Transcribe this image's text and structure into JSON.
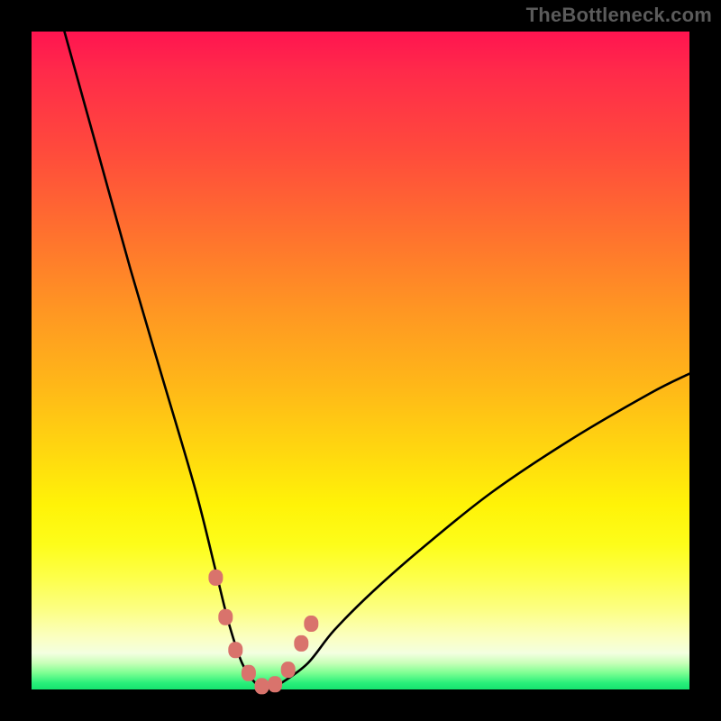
{
  "watermark": "TheBottleneck.com",
  "chart_data": {
    "type": "line",
    "title": "",
    "xlabel": "",
    "ylabel": "",
    "xlim": [
      0,
      100
    ],
    "ylim": [
      0,
      100
    ],
    "series": [
      {
        "name": "bottleneck-curve",
        "x": [
          5,
          10,
          15,
          20,
          25,
          28,
          30,
          32,
          34,
          36,
          38,
          42,
          46,
          52,
          60,
          70,
          82,
          94,
          100
        ],
        "values": [
          100,
          82,
          64,
          47,
          30,
          18,
          10,
          4,
          1,
          0,
          1,
          4,
          9,
          15,
          22,
          30,
          38,
          45,
          48
        ]
      }
    ],
    "markers": {
      "name": "highlighted-points",
      "color": "#d9736c",
      "x": [
        28,
        29.5,
        31,
        33,
        35,
        37,
        39,
        41,
        42.5
      ],
      "values": [
        17,
        11,
        6,
        2.5,
        0.5,
        0.8,
        3,
        7,
        10
      ]
    },
    "gradient_stops": [
      {
        "pos": 0.0,
        "color": "#ff1450"
      },
      {
        "pos": 0.3,
        "color": "#ff6f2f"
      },
      {
        "pos": 0.64,
        "color": "#ffd80f"
      },
      {
        "pos": 0.83,
        "color": "#fdff4a"
      },
      {
        "pos": 0.96,
        "color": "#c8ffb8"
      },
      {
        "pos": 1.0,
        "color": "#16e36f"
      }
    ]
  }
}
